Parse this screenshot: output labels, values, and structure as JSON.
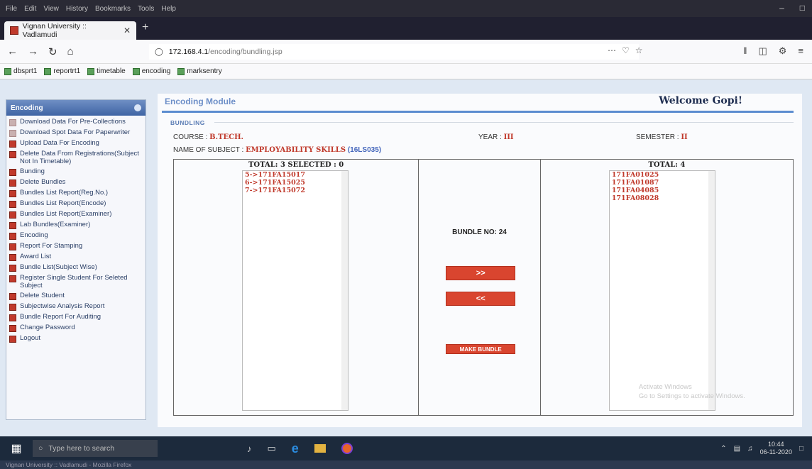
{
  "browser": {
    "menu": [
      "File",
      "Edit",
      "View",
      "History",
      "Bookmarks",
      "Tools",
      "Help"
    ],
    "tab_title": "Vignan University :: Vadlamudi",
    "url_host": "172.168.4.1",
    "url_path": "/encoding/bundling.jsp",
    "bookmarks": [
      "dbsprt1",
      "reportrt1",
      "timetable",
      "encoding",
      "marksentry"
    ]
  },
  "sidebar": {
    "header": "Encoding",
    "items": [
      "Download Data For Pre-Collections",
      "Download Spot Data For Paperwriter",
      "Upload Data For Encoding",
      "Delete Data From Registrations(Subject Not In Timetable)",
      "Bunding",
      "Delete Bundles",
      "Bundles List Report(Reg.No.)",
      "Bundles List Report(Encode)",
      "Bundles List Report(Examiner)",
      "Lab Bundles(Examiner)",
      "Encoding",
      "Report For Stamping",
      "Award List",
      "Bundle List(Subject Wise)",
      "Register Single Student For Seleted Subject",
      "Delete Student",
      "Subjectwise Analysis Report",
      "Bundle Report For Auditing",
      "Change Password",
      "Logout"
    ]
  },
  "main": {
    "module_title": "Encoding Module",
    "welcome": "Welcome Gopi!",
    "section_title": "BUNDLING",
    "course_label": "COURSE : ",
    "course_value": "B.TECH.",
    "year_label": "YEAR : ",
    "year_value": "III",
    "semester_label": "SEMESTER : ",
    "semester_value": "II",
    "subject_label": "NAME OF SUBJECT : ",
    "subject_value": "EMPLOYABILITY SKILLS",
    "subject_code": "(16LS035)",
    "left_header": "TOTAL: 3 SELECTED : 0",
    "left_items": [
      "5->171FA15017",
      "6->171FA15025",
      "7->171FA15072"
    ],
    "bundle_no": "BUNDLE NO: 24",
    "move_right": ">>",
    "move_left": "<<",
    "make_bundle": "MAKE BUNDLE",
    "right_header": "TOTAL: 4",
    "right_items": [
      "171FA01025",
      "171FA01087",
      "171FA04085",
      "171FA08028"
    ],
    "watermark_line1": "Activate Windows",
    "watermark_line2": "Go to Settings to activate Windows."
  },
  "taskbar": {
    "search_placeholder": "Type here to search",
    "time": "10:44",
    "date": "06-11-2020",
    "status": "Vignan University :: Vadlamudi - Mozilla Firefox"
  }
}
